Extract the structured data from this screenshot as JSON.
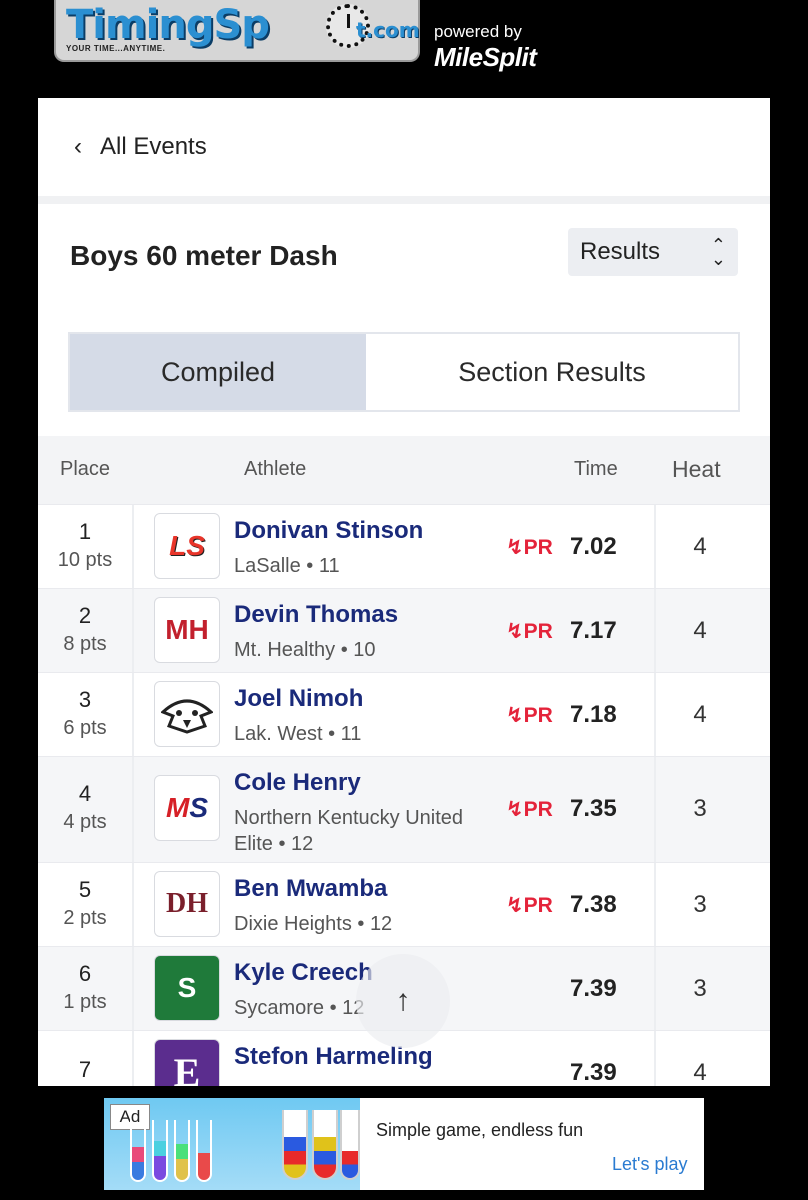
{
  "header": {
    "logo_main": "TimingSp",
    "logo_suffix": "t.com",
    "logo_tagline": "YOUR TIME...ANYTIME.",
    "powered_by": "powered by",
    "milesplit": "MileSplit"
  },
  "nav": {
    "back_label": "All Events"
  },
  "event": {
    "title": "Boys 60 meter Dash",
    "view_select": "Results"
  },
  "tabs": [
    {
      "label": "Compiled",
      "active": true
    },
    {
      "label": "Section Results",
      "active": false
    }
  ],
  "table": {
    "headers": {
      "place": "Place",
      "athlete": "Athlete",
      "time": "Time",
      "heat": "Heat"
    },
    "rows": [
      {
        "place": "1",
        "pts": "10 pts",
        "logo": "LS",
        "logo_color": "#e8352a",
        "name": "Donivan Stinson",
        "team": "LaSalle • 11",
        "pr": "PR",
        "time": "7.02",
        "heat": "4"
      },
      {
        "place": "2",
        "pts": "8 pts",
        "logo": "MH",
        "logo_color": "#c2202d",
        "name": "Devin Thomas",
        "team": "Mt. Healthy • 10",
        "pr": "PR",
        "time": "7.17",
        "heat": "4"
      },
      {
        "place": "3",
        "pts": "6 pts",
        "logo": "eagle",
        "logo_color": "#222222",
        "name": "Joel Nimoh",
        "team": "Lak. West • 11",
        "pr": "PR",
        "time": "7.18",
        "heat": "4"
      },
      {
        "place": "4",
        "pts": "4 pts",
        "logo": "MS",
        "logo_color": "#d62027",
        "name": "Cole Henry",
        "team": "Northern Kentucky United Elite • 12",
        "pr": "PR",
        "time": "7.35",
        "heat": "3"
      },
      {
        "place": "5",
        "pts": "2 pts",
        "logo": "DH",
        "logo_color": "#7a1f2b",
        "name": "Ben Mwamba",
        "team": "Dixie Heights • 12",
        "pr": "PR",
        "time": "7.38",
        "heat": "3"
      },
      {
        "place": "6",
        "pts": "1 pts",
        "logo": "S",
        "logo_color": "#1f7a3a",
        "name": "Kyle Creech",
        "team": "Sycamore • 12",
        "pr": "",
        "time": "7.39",
        "heat": "3"
      },
      {
        "place": "7",
        "pts": "",
        "logo": "E",
        "logo_color": "#5b2d8e",
        "name": "Stefon Harmeling",
        "team": "",
        "pr": "",
        "time": "7.39",
        "heat": "4"
      }
    ]
  },
  "scroll_up_icon": "arrow-up-icon",
  "ad": {
    "badge": "Ad",
    "headline": "Simple game, endless fun",
    "cta": "Let's play"
  }
}
